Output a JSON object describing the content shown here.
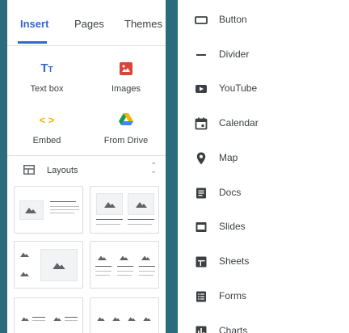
{
  "tabs": [
    {
      "label": "Insert",
      "active": true
    },
    {
      "label": "Pages",
      "active": false
    },
    {
      "label": "Themes",
      "active": false
    }
  ],
  "insert_items": [
    {
      "label": "Text box",
      "icon": "text-box-icon"
    },
    {
      "label": "Images",
      "icon": "image-icon"
    },
    {
      "label": "Embed",
      "icon": "embed-code-icon"
    },
    {
      "label": "From Drive",
      "icon": "google-drive-icon"
    }
  ],
  "layouts": {
    "label": "Layouts",
    "icon": "layouts-icon",
    "collapse_icon": "collapse-chevron-icon"
  },
  "components": [
    {
      "label": "Button",
      "icon": "button-icon"
    },
    {
      "label": "Divider",
      "icon": "divider-icon"
    },
    {
      "label": "YouTube",
      "icon": "youtube-icon"
    },
    {
      "label": "Calendar",
      "icon": "calendar-icon"
    },
    {
      "label": "Map",
      "icon": "map-pin-icon"
    },
    {
      "label": "Docs",
      "icon": "docs-icon"
    },
    {
      "label": "Slides",
      "icon": "slides-icon"
    },
    {
      "label": "Sheets",
      "icon": "sheets-icon"
    },
    {
      "label": "Forms",
      "icon": "forms-icon"
    },
    {
      "label": "Charts",
      "icon": "charts-icon"
    }
  ],
  "colors": {
    "accent": "#3367d6",
    "background": "#2a6c7b",
    "text": "#3c4043",
    "icon": "#3c4043"
  }
}
